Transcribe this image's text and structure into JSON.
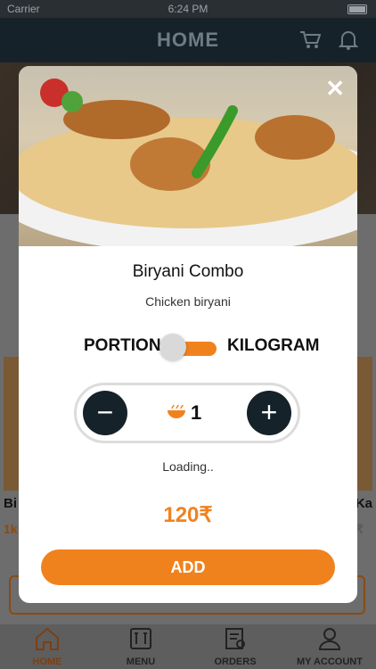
{
  "status": {
    "carrier": "Carrier",
    "time": "6:24 PM"
  },
  "header": {
    "title": "HOME",
    "cart_icon": "cart-icon",
    "bell_icon": "bell-icon"
  },
  "background": {
    "item_left_name": "Bi",
    "item_left_price": "1k",
    "item_right_name": "Ka",
    "item_right_price": "₹"
  },
  "modal": {
    "close_icon": "close-icon",
    "title": "Biryani Combo",
    "subtitle": "Chicken biryani",
    "toggle_left": "PORTION",
    "toggle_right": "KILOGRAM",
    "quantity": "1",
    "loading": "Loading..",
    "price": "120₹",
    "add_label": "ADD",
    "accent": "#F0821E",
    "dark": "#16222A"
  },
  "nav": [
    {
      "label": "HOME",
      "icon": "home-icon"
    },
    {
      "label": "MENU",
      "icon": "menu-icon"
    },
    {
      "label": "ORDERS",
      "icon": "orders-icon"
    },
    {
      "label": "MY ACCOUNT",
      "icon": "account-icon"
    }
  ]
}
